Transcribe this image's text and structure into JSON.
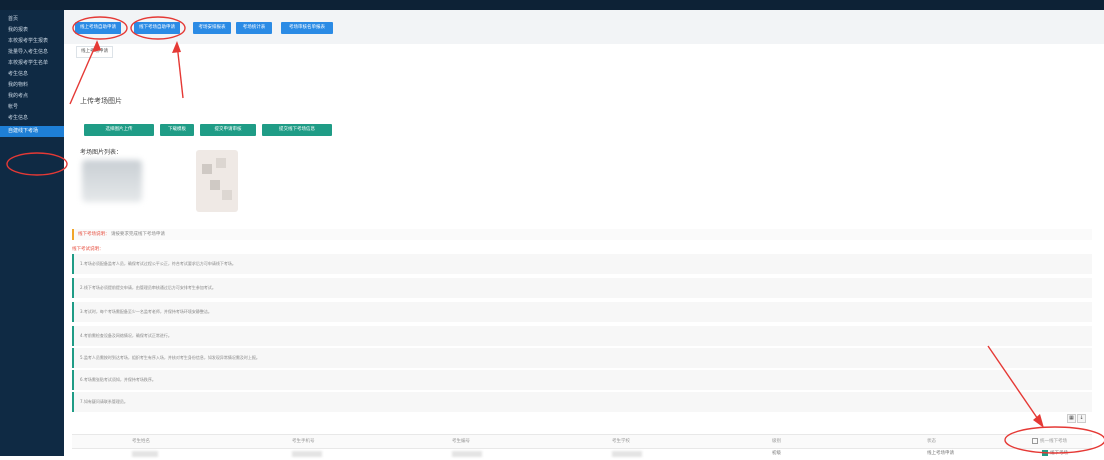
{
  "sidebar": {
    "items": [
      {
        "label": "首页"
      },
      {
        "label": "我的报表"
      },
      {
        "label": "本校报考学生报表"
      },
      {
        "label": "批量导入考生信息"
      },
      {
        "label": "本校报考学生名单"
      },
      {
        "label": "考生信息"
      },
      {
        "label": "我的物料"
      },
      {
        "label": "我的考点"
      },
      {
        "label": "帐号"
      },
      {
        "label": "考生信息"
      },
      {
        "label": "自建线下考场",
        "active": true
      }
    ]
  },
  "toolbar": {
    "buttons": [
      {
        "label": "线上考场自助申请"
      },
      {
        "label": "线下考场自助申请"
      },
      {
        "label": "考场安排报表"
      },
      {
        "label": "考场统计表"
      },
      {
        "label": "考场审核名单报表"
      }
    ]
  },
  "breadcrumb": {
    "tab": "线上考场申请"
  },
  "upload": {
    "title": "上传考场图片",
    "buttons": [
      {
        "label": "选择图片上传"
      },
      {
        "label": "下载模板"
      },
      {
        "label": "提交申请审核"
      },
      {
        "label": "提交线下考场信息"
      }
    ],
    "list_label": "考场图片列表："
  },
  "notice": {
    "prefix": "线下考场说明：",
    "text": "请按要求完成线下考场申请"
  },
  "rules": {
    "heading": "线下考试说明：",
    "items": [
      "1.考场必须配备监考人员，确保考试过程公平公正，符合考试要求后方可申请线下考场。",
      "2.线下考场必须提前提交申请，由管理员审核通过后方可安排考生参加考试。",
      "3.考试时，每个考场需配备至少一名监考老师，并保持考场环境安静整洁。",
      "4.考前需检查设备及网络情况，确保考试正常进行。",
      "5.监考人员需按时到达考场，组织考生有序入场，并核对考生身份信息，如发现异常情况需及时上报。",
      "6.考场需张贴考试须知，并保持考场秩序。",
      "7.如有疑问请联系管理员。"
    ]
  },
  "table": {
    "columns": [
      "考生姓名",
      "考生手机号",
      "考生编号",
      "考生学校",
      "级别",
      "状态"
    ],
    "select_all_label": "统一线下考场",
    "row": {
      "level": "初级",
      "status": "线上考场申请",
      "checkbox_label": "线下考场"
    }
  },
  "colors": {
    "sidebar_bg": "#0f2a44",
    "accent_blue": "#2b8be5",
    "accent_green": "#1f9c86",
    "annotation_red": "#e53935"
  }
}
